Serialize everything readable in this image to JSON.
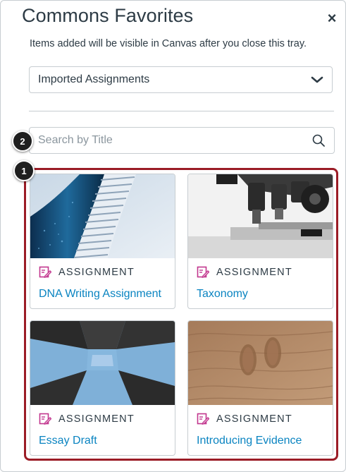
{
  "tray": {
    "title": "Commons Favorites",
    "close_glyph": "×",
    "hint": "Items added will be visible in Canvas after you close this tray."
  },
  "filter": {
    "selected": "Imported Assignments",
    "icon": "chevron-down-icon"
  },
  "search": {
    "placeholder": "Search by Title",
    "value": "",
    "icon": "search-icon"
  },
  "callouts": [
    "2",
    "1"
  ],
  "cards": [
    {
      "type": "ASSIGNMENT",
      "title": "DNA Writing Assignment",
      "image": "spiral-building-photo"
    },
    {
      "type": "ASSIGNMENT",
      "title": "Taxonomy",
      "image": "microscope-photo"
    },
    {
      "type": "ASSIGNMENT",
      "title": "Essay Draft",
      "image": "skyward-buildings-photo"
    },
    {
      "type": "ASSIGNMENT",
      "title": "Introducing Evidence",
      "image": "footprints-in-sand-photo"
    }
  ],
  "colors": {
    "link": "#0a84c1",
    "assignment_icon": "#c2368e",
    "highlight_border": "#9b1c26",
    "text": "#2d3b45"
  }
}
